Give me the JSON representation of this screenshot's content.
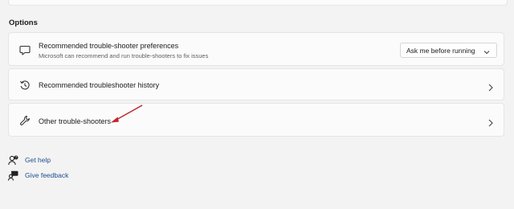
{
  "options": {
    "section_title": "Options",
    "items": [
      {
        "label": "Recommended trouble-shooter preferences",
        "description": "Microsoft can recommend and run trouble-shooters to fix issues",
        "icon": "chat-bubble-icon",
        "dropdown": {
          "selected": "Ask me before running"
        }
      },
      {
        "label": "Recommended troubleshooter history",
        "icon": "history-icon"
      },
      {
        "label": "Other trouble-shooters",
        "icon": "wrench-icon"
      }
    ]
  },
  "links": [
    {
      "label": "Get help",
      "icon": "help-person-icon"
    },
    {
      "label": "Give feedback",
      "icon": "feedback-icon"
    }
  ],
  "colors": {
    "background": "#f3f3f3",
    "card": "#fbfbfb",
    "link": "#1f4d8f",
    "annotation_arrow": "#c0262c"
  }
}
